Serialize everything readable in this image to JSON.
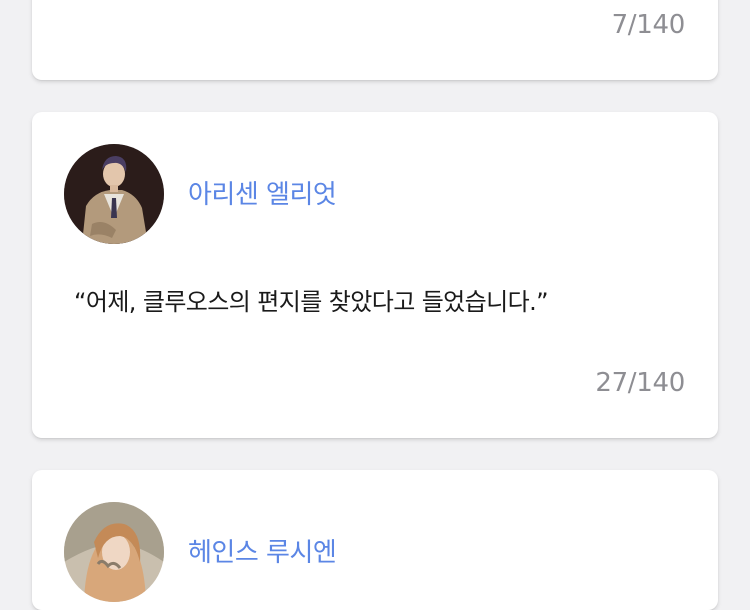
{
  "posts": [
    {
      "counter": "7/140"
    },
    {
      "author": "아리센 엘리엇",
      "quote": "“어제, 클루오스의 편지를 찾았다고 들었습니다.”",
      "counter": "27/140"
    },
    {
      "author": "헤인스 루시엔"
    }
  ],
  "colors": {
    "background": "#f1f1f3",
    "card": "#ffffff",
    "author_name": "#5b86e5",
    "counter": "#8e8e93",
    "text": "#1a1a1a"
  }
}
